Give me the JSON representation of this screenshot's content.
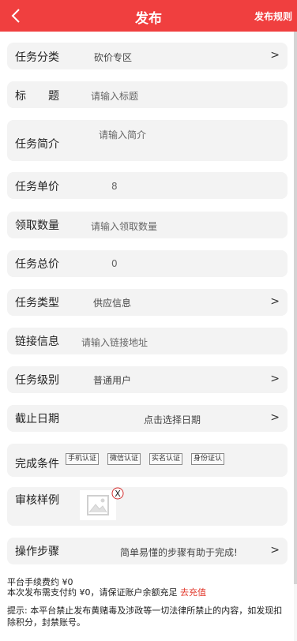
{
  "header": {
    "title": "发布",
    "rules_label": "发布规则"
  },
  "form": {
    "category": {
      "label": "任务分类",
      "value": "砍价专区",
      "arrow": ">"
    },
    "title_field": {
      "label": "标　　题",
      "placeholder": "请输入标题"
    },
    "intro": {
      "label": "任务简介",
      "placeholder": "请输入简介"
    },
    "unit_price": {
      "label": "任务单价",
      "value": "8"
    },
    "quantity": {
      "label": "领取数量",
      "placeholder": "请输入领取数量"
    },
    "total_price": {
      "label": "任务总价",
      "value": "0"
    },
    "type": {
      "label": "任务类型",
      "value": "供应信息",
      "arrow": ">"
    },
    "link": {
      "label": "链接信息",
      "placeholder": "请输入链接地址"
    },
    "level": {
      "label": "任务级别",
      "value": "普通用户",
      "arrow": ">"
    },
    "deadline": {
      "label": "截止日期",
      "value": "点击选择日期",
      "arrow": ">"
    },
    "conditions": {
      "label": "完成条件",
      "options": [
        "手机认证",
        "微信认证",
        "实名认证",
        "身份证认"
      ]
    },
    "sample": {
      "label": "审核样例",
      "delete_symbol": "X"
    },
    "steps": {
      "label": "操作步骤",
      "value": "简单易懂的步骤有助于完成!",
      "arrow": ">"
    }
  },
  "footer": {
    "fee": "平台手续费约 ¥0",
    "pay_notice": "本次发布需支付约 ¥0，请保证账户余额充足",
    "recharge_label": "去充值",
    "tip": "提示: 本平台禁止发布黄赌毒及涉政等一切法律所禁止的内容，如发现扣除积分，封禁账号。"
  },
  "colors": {
    "header_bg": "#f03f3f",
    "row_bg": "#f3f3f3",
    "recharge": "#e23a2e"
  },
  "icons": {
    "back": "chevron-left-icon",
    "image_placeholder": "image-icon",
    "delete": "close-circle-icon"
  }
}
